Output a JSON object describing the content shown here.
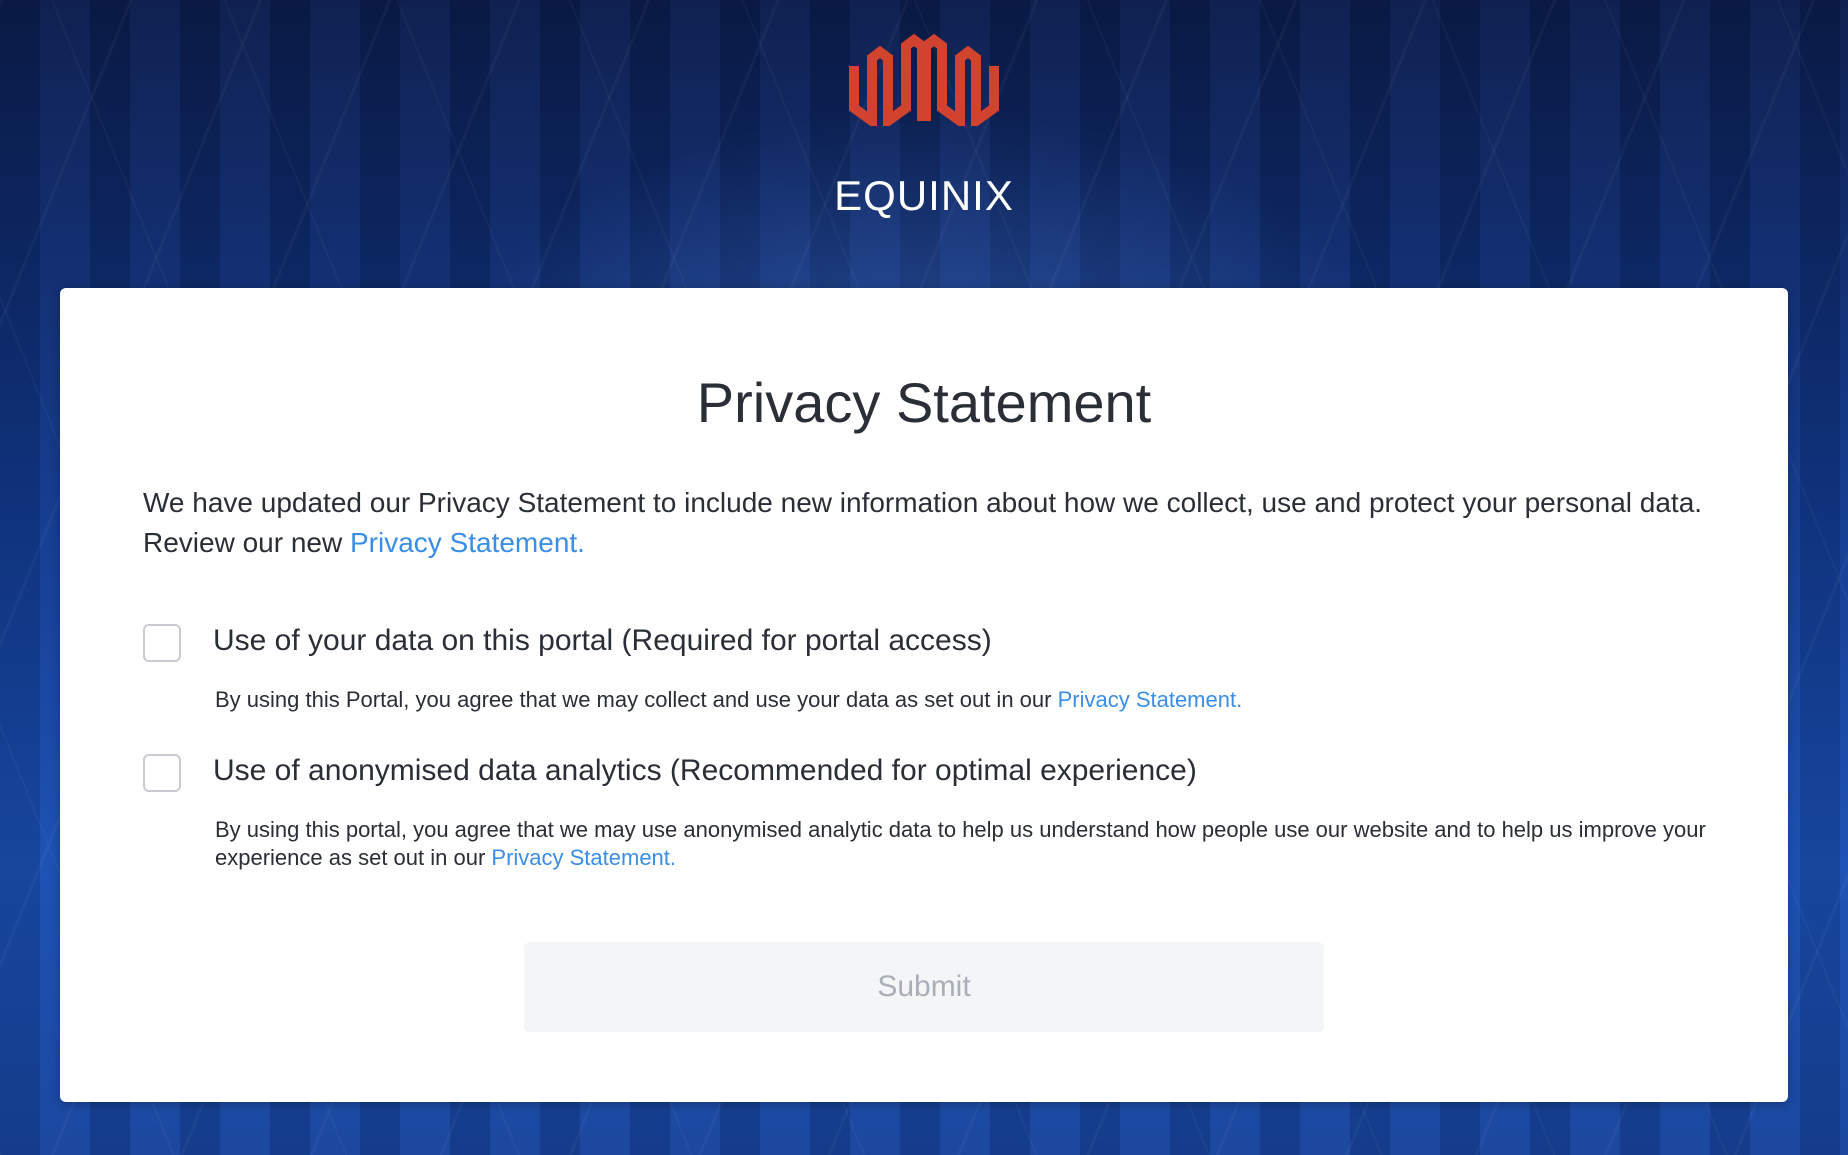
{
  "brand": {
    "name": "EQUINIX",
    "logo_icon": "equinix-logo-icon",
    "logo_color": "#d1422f"
  },
  "card": {
    "title": "Privacy Statement",
    "intro_text": "We have updated our Privacy Statement to include new information about how we collect, use and protect your personal data. Review our new ",
    "intro_link": "Privacy Statement."
  },
  "consents": [
    {
      "label": "Use of your data on this portal (Required for portal access)",
      "description": "By using this Portal, you agree that we may collect and use your data as set out in our ",
      "link": "Privacy Statement.",
      "checked": false
    },
    {
      "label": "Use of anonymised data analytics (Recommended for optimal experience)",
      "description": "By using this portal, you agree that we may use anonymised analytic data to help us understand how people use our website and to help us improve your experience as set out in our ",
      "link": "Privacy Statement.",
      "checked": false
    }
  ],
  "submit": {
    "label": "Submit",
    "disabled": true
  },
  "colors": {
    "link": "#3a8ee6",
    "text": "#2a2e36",
    "button_bg": "#f4f5f7",
    "button_text": "#a9afb7"
  }
}
